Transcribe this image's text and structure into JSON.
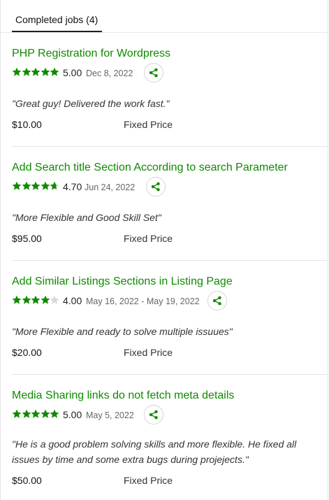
{
  "tab": {
    "label": "Completed jobs (4)"
  },
  "colors": {
    "accent": "#108a00",
    "star_empty": "#d9d9d9"
  },
  "jobs": [
    {
      "title": "PHP Registration for Wordpress",
      "stars": 5.0,
      "rating": "5.00",
      "date": "Dec 8, 2022",
      "feedback": "\"Great guy! Delivered the work fast.\"",
      "amount": "$10.00",
      "price_type": "Fixed Price"
    },
    {
      "title": "Add Search title Section According to search Parameter",
      "stars": 4.7,
      "rating": "4.70",
      "date": "Jun 24, 2022",
      "feedback": "\"More Flexible and Good Skill Set\"",
      "amount": "$95.00",
      "price_type": "Fixed Price"
    },
    {
      "title": "Add Similar Listings Sections in Listing Page",
      "stars": 4.0,
      "rating": "4.00",
      "date": "May 16, 2022 - May 19, 2022",
      "feedback": "\"More Flexible and ready to solve multiple issuues\"",
      "amount": "$20.00",
      "price_type": "Fixed Price"
    },
    {
      "title": "Media Sharing links do not fetch meta details",
      "stars": 5.0,
      "rating": "5.00",
      "date": "May 5, 2022",
      "feedback": "\"He is a good problem solving skills and more flexible. He fixed all issues by time and some extra bugs during projejects.\"",
      "amount": "$50.00",
      "price_type": "Fixed Price"
    }
  ]
}
